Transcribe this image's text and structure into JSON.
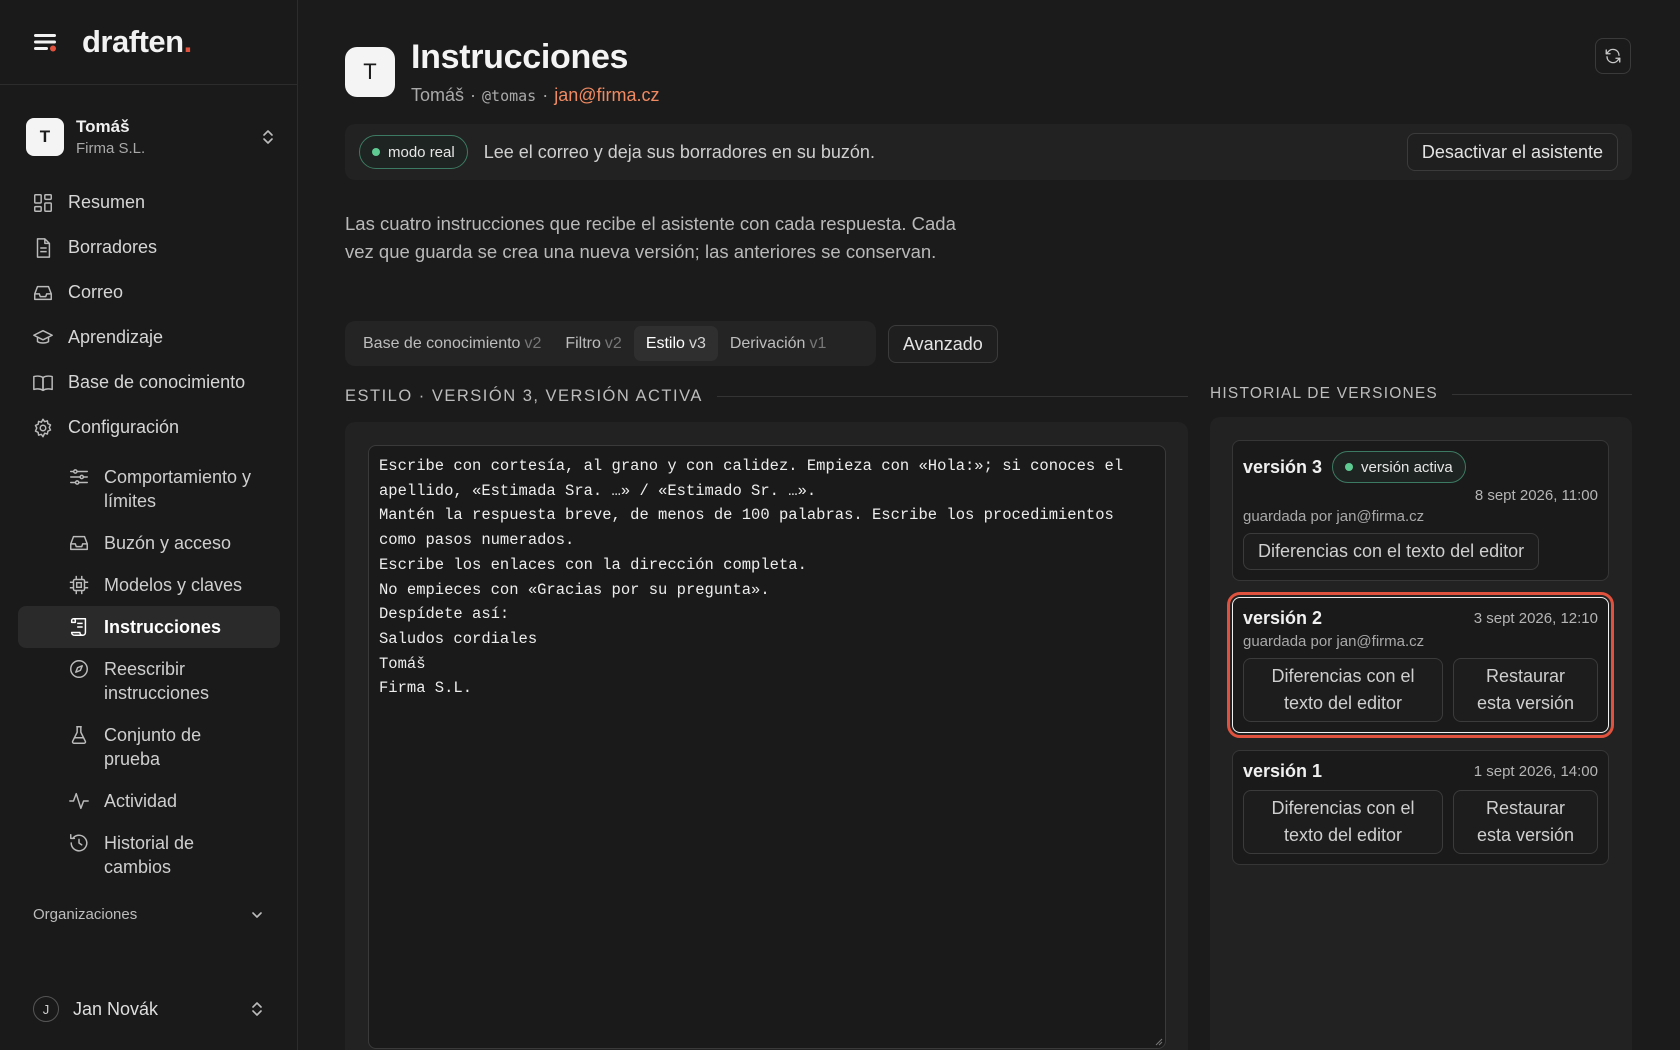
{
  "sidebar": {
    "brand": {
      "name": "draften",
      "dot": "."
    },
    "account": {
      "initial": "T",
      "name": "Tomáš",
      "org": "Firma S.L."
    },
    "nav": [
      {
        "label": "Resumen",
        "icon": "dashboard-icon"
      },
      {
        "label": "Borradores",
        "icon": "document-icon"
      },
      {
        "label": "Correo",
        "icon": "inbox-icon"
      },
      {
        "label": "Aprendizaje",
        "icon": "graduation-cap-icon"
      },
      {
        "label": "Base de conocimiento",
        "icon": "book-icon"
      },
      {
        "label": "Configuración",
        "icon": "gear-icon"
      }
    ],
    "sub_nav": [
      {
        "label": "Comportamiento y límites",
        "icon": "sliders-icon"
      },
      {
        "label": "Buzón y acceso",
        "icon": "inbox-icon"
      },
      {
        "label": "Modelos y claves",
        "icon": "chip-icon"
      },
      {
        "label": "Instrucciones",
        "icon": "scroll-icon"
      },
      {
        "label": "Reescribir instrucciones",
        "icon": "compass-icon"
      },
      {
        "label": "Conjunto de prueba",
        "icon": "flask-icon"
      },
      {
        "label": "Actividad",
        "icon": "activity-icon"
      },
      {
        "label": "Historial de cambios",
        "icon": "history-icon"
      }
    ],
    "orgs_label": "Organizaciones",
    "user": {
      "initial": "J",
      "name": "Jan Novák"
    }
  },
  "header": {
    "avatar_initial": "T",
    "title": "Instrucciones",
    "user_name": "Tomáš",
    "sep": "·",
    "handle": "@tomas",
    "email": "jan@firma.cz"
  },
  "banner": {
    "mode_label": "modo real",
    "text": "Lee el correo y deja sus borradores en su buzón.",
    "deactivate_label": "Desactivar el asistente"
  },
  "description": "Las cuatro instrucciones que recibe el asistente con cada respuesta. Cada vez que guarda se crea una nueva versión; las anteriores se conservan.",
  "tabs": [
    {
      "label": "Base de conocimiento",
      "version": "v2"
    },
    {
      "label": "Filtro",
      "version": "v2"
    },
    {
      "label": "Estilo",
      "version": "v3"
    },
    {
      "label": "Derivación",
      "version": "v1"
    }
  ],
  "advanced_label": "Avanzado",
  "editor": {
    "heading": "ESTILO · VERSIÓN 3, VERSIÓN ACTIVA",
    "content": "Escribe con cortesía, al grano y con calidez. Empieza con «Hola:»; si conoces el apellido, «Estimada Sra. …» / «Estimado Sr. …».\nMantén la respuesta breve, de menos de 100 palabras. Escribe los procedimientos como pasos numerados.\nEscribe los enlaces con la dirección completa.\nNo empieces con «Gracias por su pregunta».\nDespídete así:\nSaludos cordiales\nTomáš\nFirma S.L."
  },
  "history": {
    "heading": "HISTORIAL DE VERSIONES",
    "versions": [
      {
        "label": "versión 3",
        "active_badge": "versión activa",
        "date": "8 sept 2026, 11:00",
        "saved_by": "guardada por jan@firma.cz",
        "diff_label": "Diferencias con el texto del editor"
      },
      {
        "label": "versión 2",
        "date": "3 sept 2026, 12:10",
        "saved_by": "guardada por jan@firma.cz",
        "diff_label": "Diferencias con el texto del editor",
        "restore_label": "Restaurar esta versión"
      },
      {
        "label": "versión 1",
        "date": "1 sept 2026, 14:00",
        "diff_label": "Diferencias con el texto del editor",
        "restore_label": "Restaurar esta versión"
      }
    ]
  },
  "colors": {
    "accent": "#e0523d",
    "email": "#ef8a62",
    "status_green": "#5ecb92",
    "background": "#1b1b1b"
  }
}
